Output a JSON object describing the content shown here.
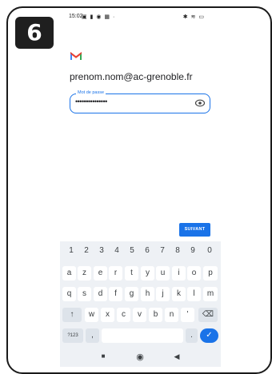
{
  "step": {
    "number": "6"
  },
  "status_bar": {
    "time": "15:02",
    "sys_icons": "▣ ▮ ◉ ▦ ·",
    "right_icons": "✱ ≋ ▭"
  },
  "account": {
    "email": "prenom.nom@ac-grenoble.fr"
  },
  "password": {
    "label": "Mot de passe",
    "value": "•••••••••••••••"
  },
  "actions": {
    "next": "SUIVANT"
  },
  "keyboard": {
    "numbers": [
      "1",
      "2",
      "3",
      "4",
      "5",
      "6",
      "7",
      "8",
      "9",
      "0"
    ],
    "row1": [
      "a",
      "z",
      "e",
      "r",
      "t",
      "y",
      "u",
      "i",
      "o",
      "p"
    ],
    "row2": [
      "q",
      "s",
      "d",
      "f",
      "g",
      "h",
      "j",
      "k",
      "l",
      "m"
    ],
    "row3": [
      "w",
      "x",
      "c",
      "v",
      "b",
      "n",
      "'"
    ],
    "shift": "↑",
    "backspace": "⌫",
    "symbols": "?123",
    "comma": ",",
    "period": ".",
    "enter": "✓"
  },
  "navbar": {
    "back": "◀",
    "home": "◉",
    "recents": "■"
  },
  "colors": {
    "accent": "#1a73e8",
    "gmail_red": "#d93025"
  }
}
